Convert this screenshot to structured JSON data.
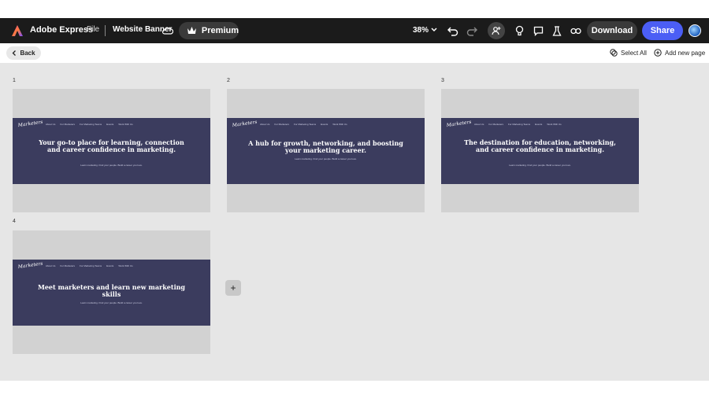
{
  "topbar": {
    "app_name": "Adobe Express",
    "file_menu": "File",
    "doc_title": "Website Banner",
    "premium_label": "Premium",
    "zoom": "38%",
    "download_label": "Download",
    "share_label": "Share",
    "colors": {
      "share": "#4b5ef5",
      "bar": "#1b1b1b"
    }
  },
  "subbar": {
    "back_label": "Back",
    "select_all_label": "Select All",
    "add_page_label": "Add new page"
  },
  "nav": [
    "About Us",
    "For Marketers",
    "For Marketing Teams",
    "Events",
    "Work With Us"
  ],
  "pages": [
    {
      "num": "1",
      "headline": "Your go-to place for learning, connection and career confidence in marketing.",
      "sub": "Learn marketing. Find your people. Build a career you love."
    },
    {
      "num": "2",
      "headline": "A hub for growth, networking, and boosting your marketing career.",
      "sub": "Learn marketing. Find your people. Build a career you love."
    },
    {
      "num": "3",
      "headline": "The destination for education, networking, and career confidence in marketing.",
      "sub": "Learn marketing. Find your people. Build a career you love."
    },
    {
      "num": "4",
      "headline": "Meet marketers and learn new marketing skills",
      "sub": "Learn marketing. Find your people. Build a career you love."
    }
  ],
  "add_button": "+"
}
